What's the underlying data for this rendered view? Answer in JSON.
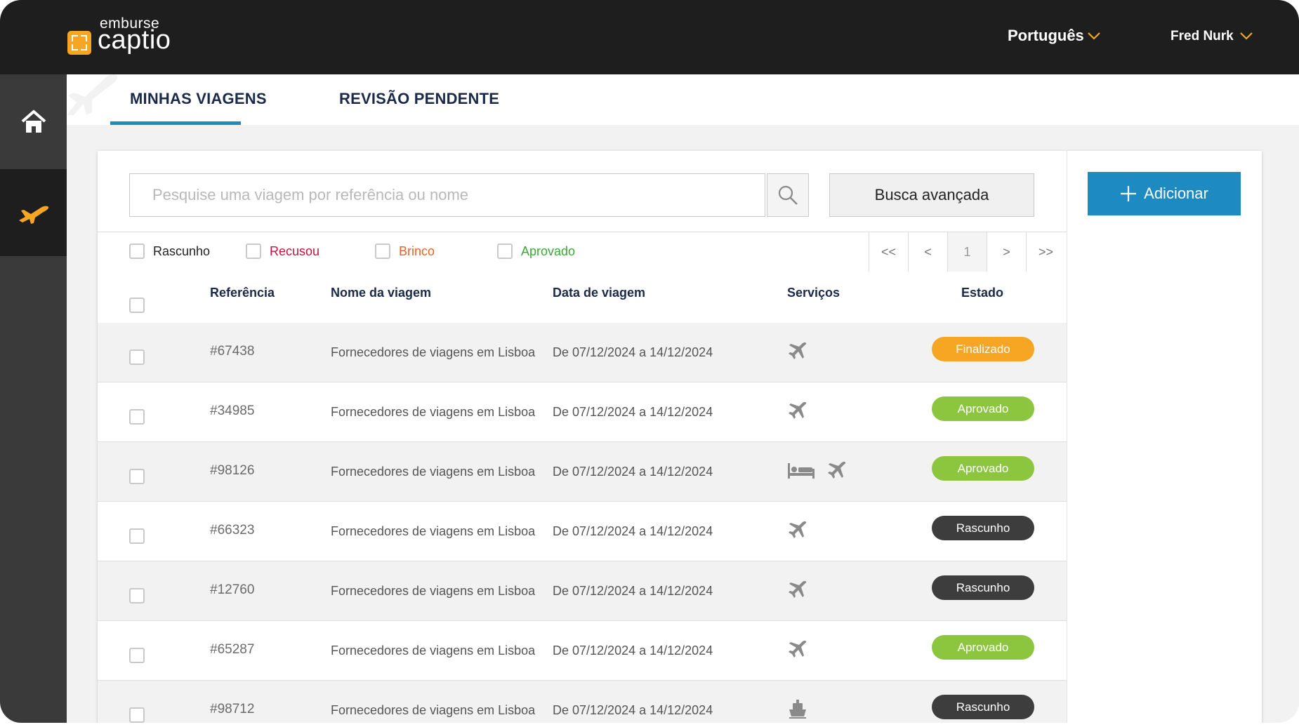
{
  "app": {
    "brand_small": "emburse",
    "brand_product": "captio",
    "language": "Português",
    "user": "Fred Nurk"
  },
  "tabs": [
    {
      "label": "MINHAS VIAGENS"
    },
    {
      "label": "REVISÃO PENDENTE"
    }
  ],
  "search": {
    "placeholder": "Pesquise uma viagem por referência ou nome",
    "advanced_label": "Busca avançada"
  },
  "add_button": {
    "label": "Adicionar"
  },
  "filters": [
    {
      "label": "Rascunho",
      "color": "#222222"
    },
    {
      "label": "Recusou",
      "color": "#c0143c"
    },
    {
      "label": "Brinco",
      "color": "#e8622a"
    },
    {
      "label": "Aprovado",
      "color": "#3aa835"
    }
  ],
  "pagination": {
    "first": "<<",
    "prev": "<",
    "current": "1",
    "next": ">",
    "last": ">>"
  },
  "table": {
    "headers": {
      "reference": "Referência",
      "name": "Nome da viagem",
      "date": "Data de viagem",
      "services": "Serviços",
      "status": "Estado"
    },
    "rows": [
      {
        "reference": "#67438",
        "name": "Fornecedores de viagens em Lisboa",
        "date": "De 07/12/2024 a 14/12/2024",
        "services": [
          "plane-icon"
        ],
        "status": "Finalizado"
      },
      {
        "reference": "#34985",
        "name": "Fornecedores de viagens em Lisboa",
        "date": "De 07/12/2024 a 14/12/2024",
        "services": [
          "plane-icon"
        ],
        "status": "Aprovado"
      },
      {
        "reference": "#98126",
        "name": "Fornecedores de viagens em Lisboa",
        "date": "De 07/12/2024 a 14/12/2024",
        "services": [
          "bed-icon",
          "plane-icon"
        ],
        "status": "Aprovado"
      },
      {
        "reference": "#66323",
        "name": "Fornecedores de viagens em Lisboa",
        "date": "De 07/12/2024 a 14/12/2024",
        "services": [
          "plane-icon"
        ],
        "status": "Rascunho"
      },
      {
        "reference": "#12760",
        "name": "Fornecedores de viagens em Lisboa",
        "date": "De 07/12/2024 a 14/12/2024",
        "services": [
          "plane-icon"
        ],
        "status": "Rascunho"
      },
      {
        "reference": "#65287",
        "name": "Fornecedores de viagens em Lisboa",
        "date": "De 07/12/2024 a 14/12/2024",
        "services": [
          "plane-icon"
        ],
        "status": "Aprovado"
      },
      {
        "reference": "#98712",
        "name": "Fornecedores de viagens em Lisboa",
        "date": "De 07/12/2024 a 14/12/2024",
        "services": [
          "ship-icon"
        ],
        "status": "Rascunho"
      }
    ]
  },
  "status_colors": {
    "Finalizado": "#f6a623",
    "Aprovado": "#8cc63f",
    "Rascunho": "#3d3d3d"
  },
  "colors": {
    "accent": "#1d8bc1",
    "sidebar_active_icon": "#f6a623"
  }
}
